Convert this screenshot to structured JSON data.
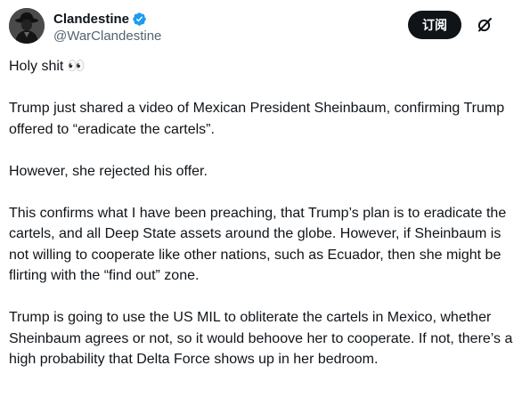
{
  "author": {
    "display_name": "Clandestine",
    "handle": "@WarClandestine",
    "verified": true,
    "verified_color": "#1d9bf0"
  },
  "actions": {
    "subscribe_label": "订阅",
    "subscribe_bg": "#0f1419",
    "grok_icon": "grok-icon"
  },
  "tweet": {
    "paragraphs": [
      "Holy shit 👀",
      "Trump just shared a video of Mexican President Sheinbaum, confirming Trump offered to “eradicate the cartels”.",
      "However, she rejected his offer.",
      "This confirms what I have been preaching, that Trump’s plan is to eradicate the cartels, and all Deep State assets around the globe. However, if Sheinbaum is not willing to cooperate like other nations, such as Ecuador, then she might be flirting with the “find out” zone.",
      "Trump is going to use the US MIL to obliterate the cartels in Mexico, whether Sheinbaum agrees or not, so it would behoove her to cooperate. If not, there’s a high probability that Delta Force shows up in her bedroom."
    ]
  }
}
